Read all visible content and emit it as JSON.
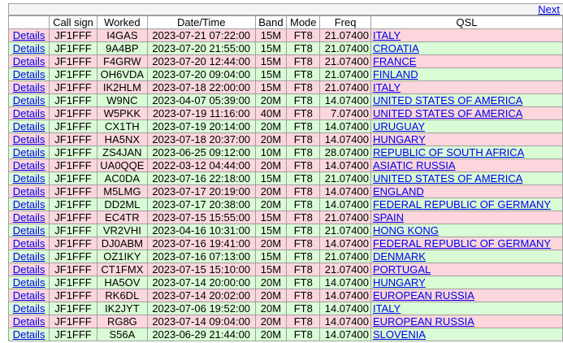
{
  "nav": {
    "next_label": "Next"
  },
  "table": {
    "headers": [
      "",
      "Call sign",
      "Worked",
      "Date/Time",
      "Band",
      "Mode",
      "Freq",
      "QSL"
    ],
    "details_label": "Details",
    "rows": [
      {
        "call": "JF1FFF",
        "worked": "I4GAS",
        "datetime": "2023-07-21 07:22:00",
        "band": "15M",
        "mode": "FT8",
        "freq": "21.07400",
        "qsl": "ITALY",
        "color": "pink"
      },
      {
        "call": "JF1FFF",
        "worked": "9A4BP",
        "datetime": "2023-07-20 21:55:00",
        "band": "15M",
        "mode": "FT8",
        "freq": "21.07400",
        "qsl": "CROATIA",
        "color": "green"
      },
      {
        "call": "JF1FFF",
        "worked": "F4GRW",
        "datetime": "2023-07-20 12:44:00",
        "band": "15M",
        "mode": "FT8",
        "freq": "21.07400",
        "qsl": "FRANCE",
        "color": "pink"
      },
      {
        "call": "JF1FFF",
        "worked": "OH6VDA",
        "datetime": "2023-07-20 09:04:00",
        "band": "15M",
        "mode": "FT8",
        "freq": "21.07400",
        "qsl": "FINLAND",
        "color": "green"
      },
      {
        "call": "JF1FFF",
        "worked": "IK2HLM",
        "datetime": "2023-07-18 22:00:00",
        "band": "15M",
        "mode": "FT8",
        "freq": "21.07400",
        "qsl": "ITALY",
        "color": "pink"
      },
      {
        "call": "JF1FFF",
        "worked": "W9NC",
        "datetime": "2023-04-07 05:39:00",
        "band": "20M",
        "mode": "FT8",
        "freq": "14.07400",
        "qsl": "UNITED STATES OF AMERICA",
        "color": "green"
      },
      {
        "call": "JF1FFF",
        "worked": "W5PKK",
        "datetime": "2023-07-19 11:16:00",
        "band": "40M",
        "mode": "FT8",
        "freq": "7.07400",
        "qsl": "UNITED STATES OF AMERICA",
        "color": "pink"
      },
      {
        "call": "JF1FFF",
        "worked": "CX1TH",
        "datetime": "2023-07-19 20:14:00",
        "band": "20M",
        "mode": "FT8",
        "freq": "14.07400",
        "qsl": "URUGUAY",
        "color": "green"
      },
      {
        "call": "JF1FFF",
        "worked": "HA5NX",
        "datetime": "2023-07-18 20:37:00",
        "band": "20M",
        "mode": "FT8",
        "freq": "14.07400",
        "qsl": "HUNGARY",
        "color": "pink"
      },
      {
        "call": "JF1FFF",
        "worked": "ZS4JAN",
        "datetime": "2023-06-25 09:12:00",
        "band": "10M",
        "mode": "FT8",
        "freq": "28.07400",
        "qsl": "REPUBLIC OF SOUTH AFRICA",
        "color": "green"
      },
      {
        "call": "JF1FFF",
        "worked": "UA0QQE",
        "datetime": "2022-03-12 04:44:00",
        "band": "20M",
        "mode": "FT8",
        "freq": "14.07400",
        "qsl": "ASIATIC RUSSIA",
        "color": "pink"
      },
      {
        "call": "JF1FFF",
        "worked": "AC0DA",
        "datetime": "2023-07-16 22:18:00",
        "band": "15M",
        "mode": "FT8",
        "freq": "21.07400",
        "qsl": "UNITED STATES OF AMERICA",
        "color": "green"
      },
      {
        "call": "JF1FFF",
        "worked": "M5LMG",
        "datetime": "2023-07-17 20:19:00",
        "band": "20M",
        "mode": "FT8",
        "freq": "14.07400",
        "qsl": "ENGLAND",
        "color": "pink"
      },
      {
        "call": "JF1FFF",
        "worked": "DD2ML",
        "datetime": "2023-07-17 20:38:00",
        "band": "20M",
        "mode": "FT8",
        "freq": "14.07400",
        "qsl": "FEDERAL REPUBLIC OF GERMANY",
        "color": "green"
      },
      {
        "call": "JF1FFF",
        "worked": "EC4TR",
        "datetime": "2023-07-15 15:55:00",
        "band": "15M",
        "mode": "FT8",
        "freq": "21.07400",
        "qsl": "SPAIN",
        "color": "pink"
      },
      {
        "call": "JF1FFF",
        "worked": "VR2VHI",
        "datetime": "2023-04-16 10:31:00",
        "band": "15M",
        "mode": "FT8",
        "freq": "21.07400",
        "qsl": "HONG KONG",
        "color": "green"
      },
      {
        "call": "JF1FFF",
        "worked": "DJ0ABM",
        "datetime": "2023-07-16 19:41:00",
        "band": "20M",
        "mode": "FT8",
        "freq": "14.07400",
        "qsl": "FEDERAL REPUBLIC OF GERMANY",
        "color": "pink"
      },
      {
        "call": "JF1FFF",
        "worked": "OZ1IKY",
        "datetime": "2023-07-16 07:13:00",
        "band": "15M",
        "mode": "FT8",
        "freq": "21.07400",
        "qsl": "DENMARK",
        "color": "green"
      },
      {
        "call": "JF1FFF",
        "worked": "CT1FMX",
        "datetime": "2023-07-15 15:10:00",
        "band": "15M",
        "mode": "FT8",
        "freq": "21.07400",
        "qsl": "PORTUGAL",
        "color": "pink"
      },
      {
        "call": "JF1FFF",
        "worked": "HA5OV",
        "datetime": "2023-07-14 20:00:00",
        "band": "20M",
        "mode": "FT8",
        "freq": "14.07400",
        "qsl": "HUNGARY",
        "color": "green"
      },
      {
        "call": "JF1FFF",
        "worked": "RK6DL",
        "datetime": "2023-07-14 20:02:00",
        "band": "20M",
        "mode": "FT8",
        "freq": "14.07400",
        "qsl": "EUROPEAN RUSSIA",
        "color": "pink"
      },
      {
        "call": "JF1FFF",
        "worked": "IK2JYT",
        "datetime": "2023-07-06 19:52:00",
        "band": "20M",
        "mode": "FT8",
        "freq": "14.07400",
        "qsl": "ITALY",
        "color": "green"
      },
      {
        "call": "JF1FFF",
        "worked": "RG8G",
        "datetime": "2023-07-14 09:04:00",
        "band": "20M",
        "mode": "FT8",
        "freq": "14.07400",
        "qsl": "EUROPEAN RUSSIA",
        "color": "pink"
      },
      {
        "call": "JF1FFF",
        "worked": "S56A",
        "datetime": "2023-06-29 21:44:00",
        "band": "20M",
        "mode": "FT8",
        "freq": "14.07400",
        "qsl": "SLOVENIA",
        "color": "green"
      }
    ]
  },
  "colors": {
    "pink_row": "#fcd6dc",
    "green_row": "#d9fbd5",
    "link": "#0000ee",
    "border": "#a0a0a0"
  }
}
